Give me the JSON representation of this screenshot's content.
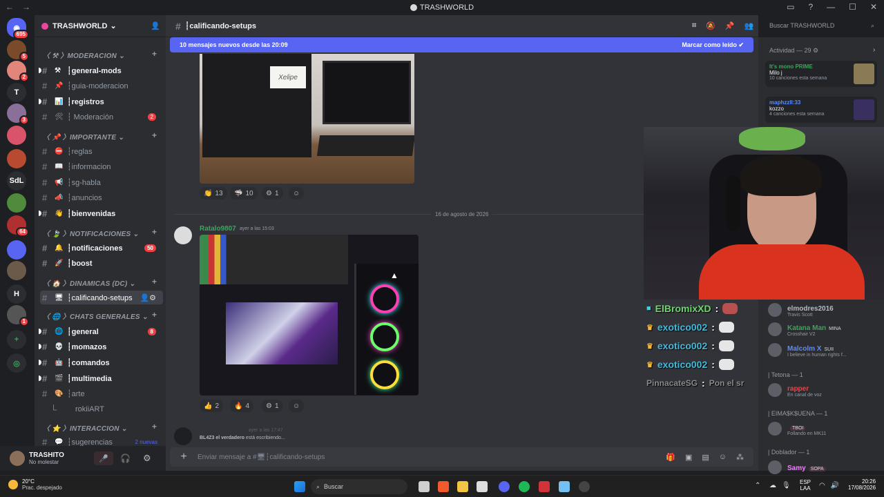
{
  "titlebar": {
    "title": "TRASHWORLD"
  },
  "rail": {
    "home_badge": "695",
    "servers": [
      {
        "label": "",
        "color": "#7a4b2a",
        "badge": "5"
      },
      {
        "label": "",
        "color": "#e2857a",
        "badge": "2"
      },
      {
        "label": "T",
        "color": "#2b2d31",
        "badge": ""
      },
      {
        "label": "",
        "color": "#8a6f99",
        "badge": "3"
      },
      {
        "label": "",
        "color": "#d9536b",
        "badge": ""
      },
      {
        "label": "",
        "color": "#b84a2f",
        "badge": ""
      },
      {
        "label": "SdL",
        "color": "#2b2d31",
        "badge": ""
      },
      {
        "label": "",
        "color": "#4f8a3d",
        "badge": ""
      },
      {
        "label": "",
        "color": "#b03030",
        "badge": "64"
      },
      {
        "label": "",
        "color": "#5865f2",
        "badge": ""
      },
      {
        "label": "",
        "color": "#6b5a4a",
        "badge": ""
      },
      {
        "label": "H",
        "color": "#2b2d31",
        "badge": ""
      },
      {
        "label": "",
        "color": "#555",
        "badge": "1"
      }
    ]
  },
  "sidebar": {
    "server_name": "TRASHWORLD",
    "categories": [
      {
        "label": "〈 ⚒ 〉MODERACION"
      },
      {
        "label": "〈 📌 〉IMPORTANTE"
      },
      {
        "label": "〈 🍃 〉NOTIFICACIONES"
      },
      {
        "label": "〈 🏠 〉DINAMICAS (DC)"
      },
      {
        "label": "〈 🌐 〉CHATS GENERALES"
      },
      {
        "label": "〈 ⭐ 〉INTERACCION"
      }
    ],
    "channels": [
      {
        "emoji": "⚒",
        "label": "┆general-mods",
        "badge": ""
      },
      {
        "emoji": "📌",
        "label": "┆guia-moderacion",
        "badge": ""
      },
      {
        "emoji": "📊",
        "label": "┆registros",
        "badge": ""
      },
      {
        "emoji": "🛠",
        "label": "┆ Moderación",
        "badge": "2"
      },
      {
        "emoji": "⛔",
        "label": "┆reglas",
        "badge": ""
      },
      {
        "emoji": "📖",
        "label": "┆informacion",
        "badge": ""
      },
      {
        "emoji": "📢",
        "label": "┆sg-habla",
        "badge": ""
      },
      {
        "emoji": "📣",
        "label": "┆anuncios",
        "badge": ""
      },
      {
        "emoji": "👋",
        "label": "┆bienvenidas",
        "badge": ""
      },
      {
        "emoji": "🔔",
        "label": "┆notificaciones",
        "badge": "50"
      },
      {
        "emoji": "🚀",
        "label": "┆boost",
        "badge": ""
      },
      {
        "emoji": "🖥",
        "label": "┆calificando-setups",
        "badge": ""
      },
      {
        "emoji": "🌐",
        "label": "┆general",
        "badge": "8"
      },
      {
        "emoji": "💀",
        "label": "┆momazos",
        "badge": ""
      },
      {
        "emoji": "🤖",
        "label": "┆comandos",
        "badge": ""
      },
      {
        "emoji": "🎬",
        "label": "┆multimedia",
        "badge": ""
      },
      {
        "emoji": "🎨",
        "label": "┆arte",
        "badge": ""
      },
      {
        "emoji": "",
        "label": "rokiiART",
        "badge": ""
      },
      {
        "emoji": "💬",
        "label": "┆sugerencias",
        "badge": "2 nuevas"
      }
    ]
  },
  "user": {
    "name": "TRASHITO",
    "status": "No molestar"
  },
  "main": {
    "channel_name": "┆calificando-setups",
    "banner_text": "10 mensajes nuevos desde las 20:09",
    "banner_action": "Marcar como leído",
    "photo1_label": "Xelipe",
    "reactions1": [
      {
        "e": "👏",
        "n": "13"
      },
      {
        "e": "🦈",
        "n": "10"
      },
      {
        "e": "⚙",
        "n": "1"
      }
    ],
    "date_divider": "16 de agosto de 2026",
    "msg_author": "Ratalo9807",
    "msg_time": "ayer a las 15:03",
    "reactions2": [
      {
        "e": "👍",
        "n": "2"
      },
      {
        "e": "🔥",
        "n": "4"
      },
      {
        "e": "⚙",
        "n": "1"
      }
    ],
    "partial_time": "ayer a las 17:47",
    "typing_user": "BL4Z3 el verdadero",
    "typing_text": " está escribiendo...",
    "composer_placeholder": "Enviar mensaje a #🖥┆calificando-setups"
  },
  "search": {
    "placeholder": "Buscar TRASHWORLD"
  },
  "activity": {
    "header": "Actividad — 29 ⚙",
    "cards": [
      {
        "user": "It's mono PRIME",
        "title": "Milo j",
        "sub": "10 canciones esta semana"
      },
      {
        "user": "maphzzll:33",
        "title": "kozzo",
        "sub": "4 canciones esta semana"
      }
    ]
  },
  "members": [
    {
      "name": "elmodres2016",
      "sub": "Travis Scott",
      "color": "#b5bac1"
    },
    {
      "name": "Katana Man",
      "tag": "MINA",
      "sub": "Crosshair V2",
      "color": "#3ba55c"
    },
    {
      "name": "Malcolm X",
      "tag": "SUII",
      "sub": "I believe in human rights f...",
      "color": "#5b8cff"
    }
  ],
  "groups": [
    {
      "label": "| Tetona — 1",
      "name": "rapper",
      "sub": "En canal de voz",
      "color": "#ed4245"
    },
    {
      "label": "| EIMA$K$UENA — 1",
      "name": "",
      "tag": "TBOI",
      "sub": "Follando en MK11",
      "color": "#ed4245"
    },
    {
      "label": "| Doblador — 1",
      "name": "Samy",
      "tag": "SOPA",
      "sub": "",
      "color": "#f47fff"
    }
  ],
  "stream_chat": [
    {
      "user": "ElBromixXD",
      "sep": ":"
    },
    {
      "user": "exotico002",
      "sep": ":"
    },
    {
      "user": "exotico002",
      "sep": ":"
    },
    {
      "user": "exotico002",
      "sep": ":"
    },
    {
      "user": "PinnacateSG",
      "sep": ":",
      "msg": "Pon el sr"
    }
  ],
  "taskbar": {
    "temp": "20°C",
    "weather": "Prac. despejado",
    "search": "Buscar",
    "lang1": "ESP",
    "lang2": "LAA",
    "time": "20:26",
    "date": "17/08/2026"
  }
}
